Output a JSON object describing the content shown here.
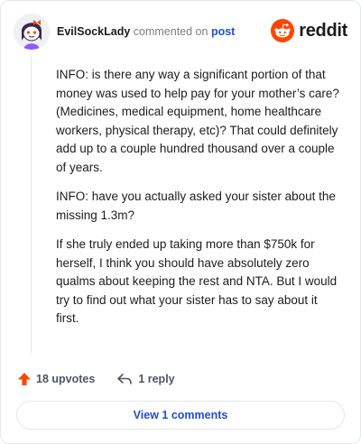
{
  "header": {
    "username": "EvilSockLady",
    "action": "commented on",
    "target": "post",
    "brand": "reddit"
  },
  "comment": {
    "paragraphs": [
      "INFO: is there any way a significant portion of that money was used to help pay for your mother’s care? (Medicines, medical equipment, home healthcare workers, physical therapy, etc)? That could definitely add up to a couple hundred thousand over a couple of years.",
      "INFO: have you actually asked your sister about the missing 1.3m?",
      "If she truly ended up taking more than $750k for herself, I think you should have absolutely zero qualms about keeping the rest and NTA. But I would try to find out what your sister has to say about it first."
    ]
  },
  "footer": {
    "upvotes": "18 upvotes",
    "replies": "1 reply",
    "view_button": "View 1 comments"
  },
  "colors": {
    "accent": "#ff4500",
    "link": "#1d4ed8"
  },
  "icons": {
    "avatar": "snoo-avatar",
    "logo": "reddit-logo-icon",
    "upvote": "upvote-arrow-icon",
    "reply": "reply-arrow-icon"
  }
}
